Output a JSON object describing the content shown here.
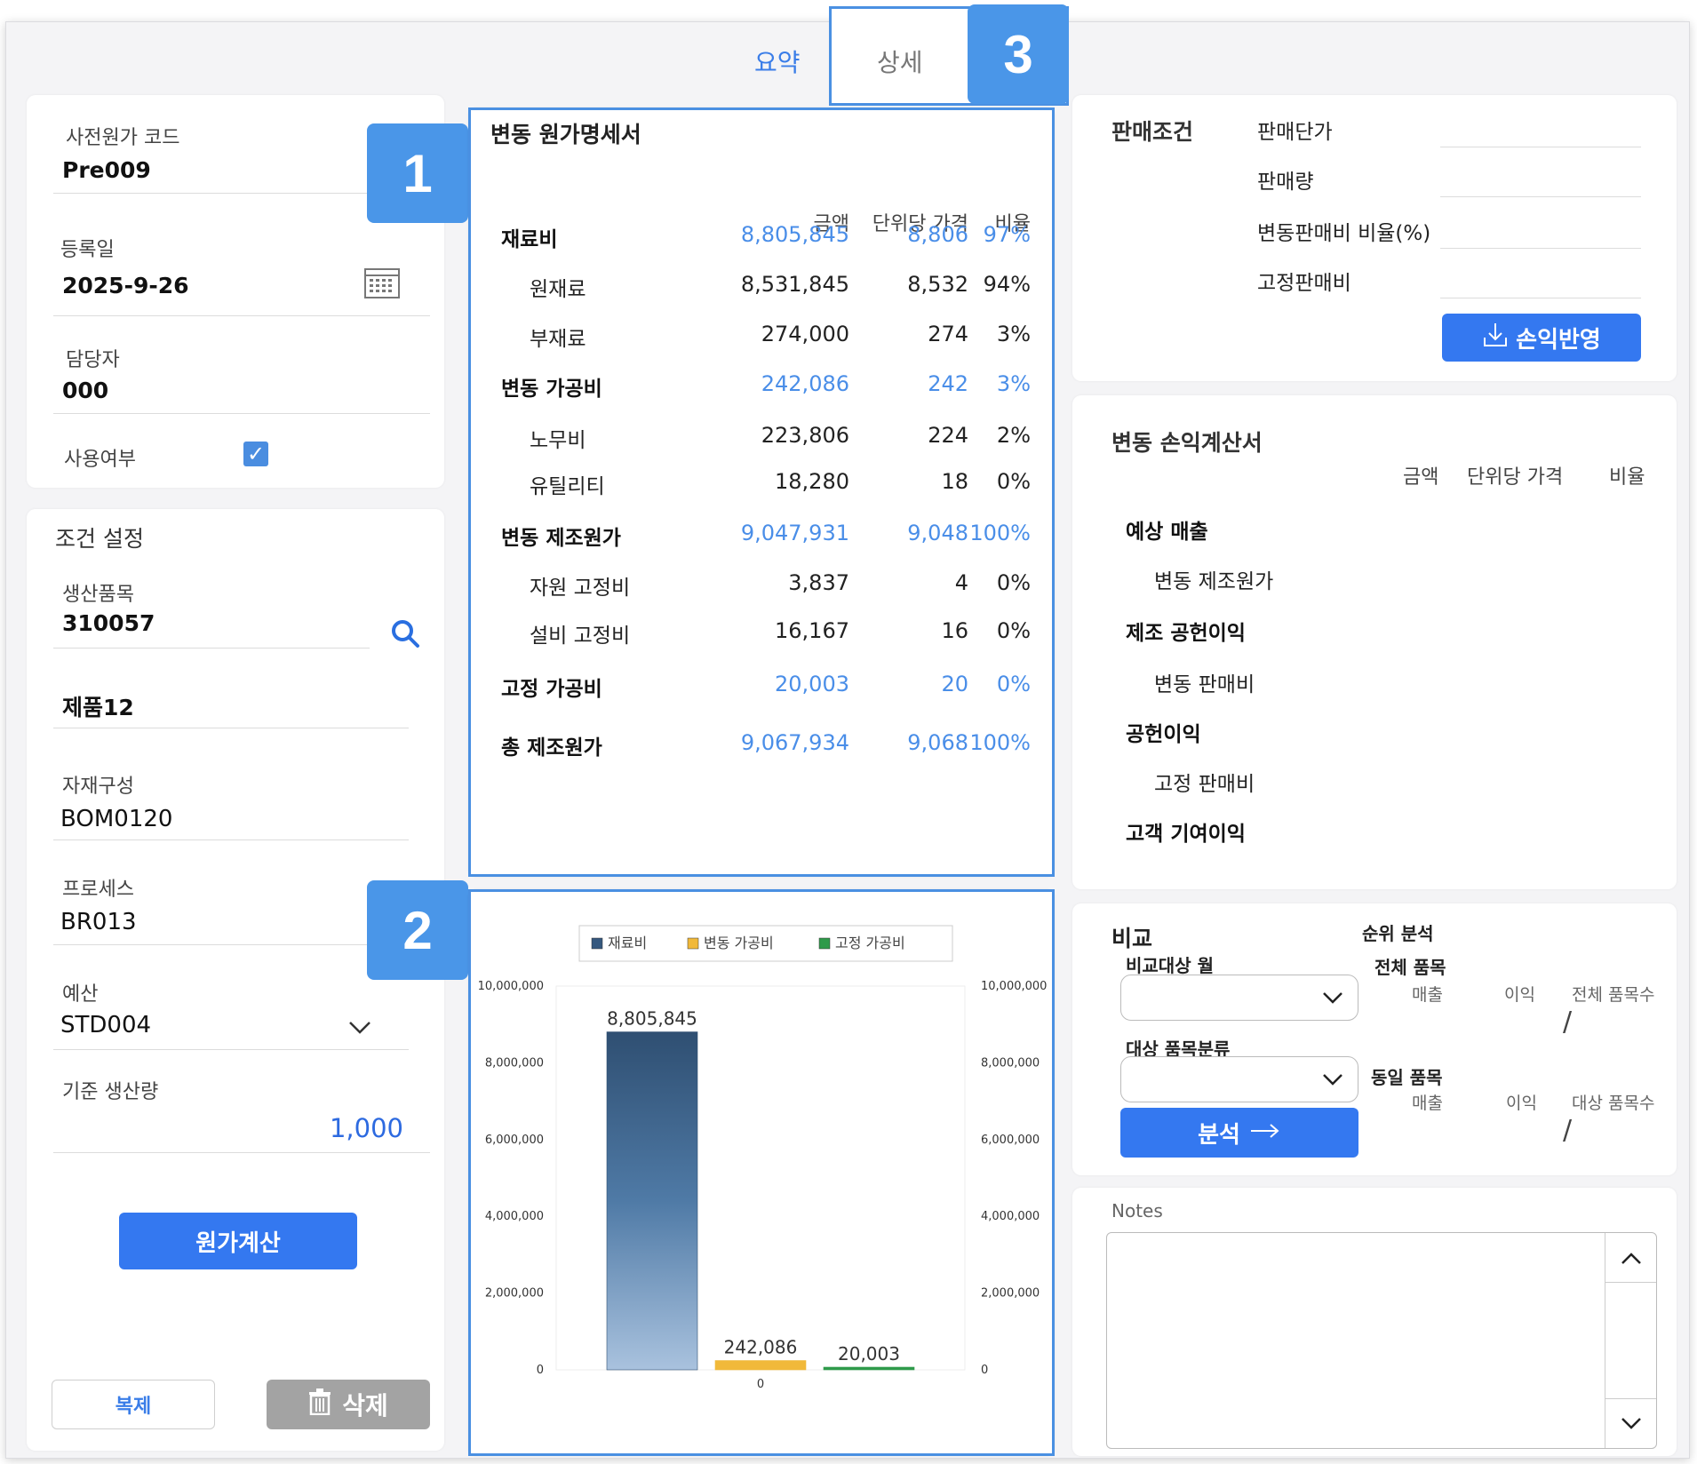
{
  "tabs": {
    "summary": "요약",
    "detail": "상세"
  },
  "badges": [
    "1",
    "2",
    "3"
  ],
  "header_card": {
    "code_label": "사전원가 코드",
    "code_value": "Pre009",
    "date_label": "등록일",
    "date_value": "2025-9-26",
    "manager_label": "담당자",
    "manager_value": "000",
    "use_label": "사용여부",
    "use_checked": true
  },
  "condition": {
    "title": "조건 설정",
    "product_label": "생산품목",
    "product_code": "310057",
    "product_name": "제품12",
    "bom_label": "자재구성",
    "bom_value": "BOM0120",
    "process_label": "프로세스",
    "process_value": "BR013",
    "budget_label": "예산",
    "budget_value": "STD004",
    "qty_label": "기준 생산량",
    "qty_value": "1,000",
    "calc_button": "원가계산",
    "copy_button": "복제",
    "delete_button": "삭제"
  },
  "cost_statement": {
    "title": "변동 원가명세서",
    "headers": [
      "금액",
      "단위당 가격",
      "비율"
    ],
    "rows": [
      {
        "name": "재료비",
        "amount": "8,805,845",
        "unit": "8,806",
        "ratio": "97%",
        "main": true
      },
      {
        "name": "원재료",
        "amount": "8,531,845",
        "unit": "8,532",
        "ratio": "94%",
        "main": false
      },
      {
        "name": "부재료",
        "amount": "274,000",
        "unit": "274",
        "ratio": "3%",
        "main": false
      },
      {
        "name": "변동 가공비",
        "amount": "242,086",
        "unit": "242",
        "ratio": "3%",
        "main": true
      },
      {
        "name": "노무비",
        "amount": "223,806",
        "unit": "224",
        "ratio": "2%",
        "main": false
      },
      {
        "name": "유틸리티",
        "amount": "18,280",
        "unit": "18",
        "ratio": "0%",
        "main": false
      },
      {
        "name": "변동 제조원가",
        "amount": "9,047,931",
        "unit": "9,048",
        "ratio": "100%",
        "main": true
      },
      {
        "name": "자원 고정비",
        "amount": "3,837",
        "unit": "4",
        "ratio": "0%",
        "main": false
      },
      {
        "name": "설비 고정비",
        "amount": "16,167",
        "unit": "16",
        "ratio": "0%",
        "main": false
      },
      {
        "name": "고정 가공비",
        "amount": "20,003",
        "unit": "20",
        "ratio": "0%",
        "main": true
      },
      {
        "name": "총 제조원가",
        "amount": "9,067,934",
        "unit": "9,068",
        "ratio": "100%",
        "main": true
      }
    ]
  },
  "chart_data": {
    "type": "bar",
    "categories": [
      "재료비",
      "변동 가공비",
      "고정 가공비"
    ],
    "series": [
      {
        "name": "재료비",
        "values": [
          8805845,
          null,
          null
        ],
        "color": "#35587e"
      },
      {
        "name": "변동 가공비",
        "values": [
          null,
          242086,
          null
        ],
        "color": "#f1b93a"
      },
      {
        "name": "고정 가공비",
        "values": [
          null,
          null,
          20003
        ],
        "color": "#2e9a4a"
      }
    ],
    "data_labels": [
      "8,805,845",
      "242,086",
      "20,003"
    ],
    "ylim": [
      0,
      10000000
    ],
    "yticks": [
      "0",
      "2,000,000",
      "4,000,000",
      "6,000,000",
      "8,000,000",
      "10,000,000"
    ],
    "xtick": "0",
    "legend": "top",
    "grid": false
  },
  "sales_conditions": {
    "title": "판매조건",
    "fields": [
      "판매단가",
      "판매량",
      "변동판매비 비율(%)",
      "고정판매비"
    ],
    "apply_button": "손익반영"
  },
  "pl_statement": {
    "title": "변동 손익계산서",
    "headers": [
      "금액",
      "단위당 가격",
      "비율"
    ],
    "rows": [
      {
        "name": "예상 매출",
        "main": true
      },
      {
        "name": "변동 제조원가",
        "main": false
      },
      {
        "name": "제조 공헌이익",
        "main": true
      },
      {
        "name": "변동 판매비",
        "main": false
      },
      {
        "name": "공헌이익",
        "main": true
      },
      {
        "name": "고정 판매비",
        "main": false
      },
      {
        "name": "고객 기여이익",
        "main": true
      }
    ]
  },
  "compare": {
    "title": "비교",
    "month_label": "비교대상 월",
    "category_label": "대상 품목분류",
    "analyze_button": "분석",
    "rank_title": "순위 분석",
    "all_items": "전체 품목",
    "same_items": "동일 품목",
    "sales": "매출",
    "profit": "이익",
    "all_count": "전체 품목수",
    "target_count": "대상 품목수",
    "slash": "/"
  },
  "notes": {
    "label": "Notes"
  },
  "colors": {
    "accent": "#3478f0",
    "highlight": "#4a90e2",
    "link": "#4a8ee8"
  }
}
